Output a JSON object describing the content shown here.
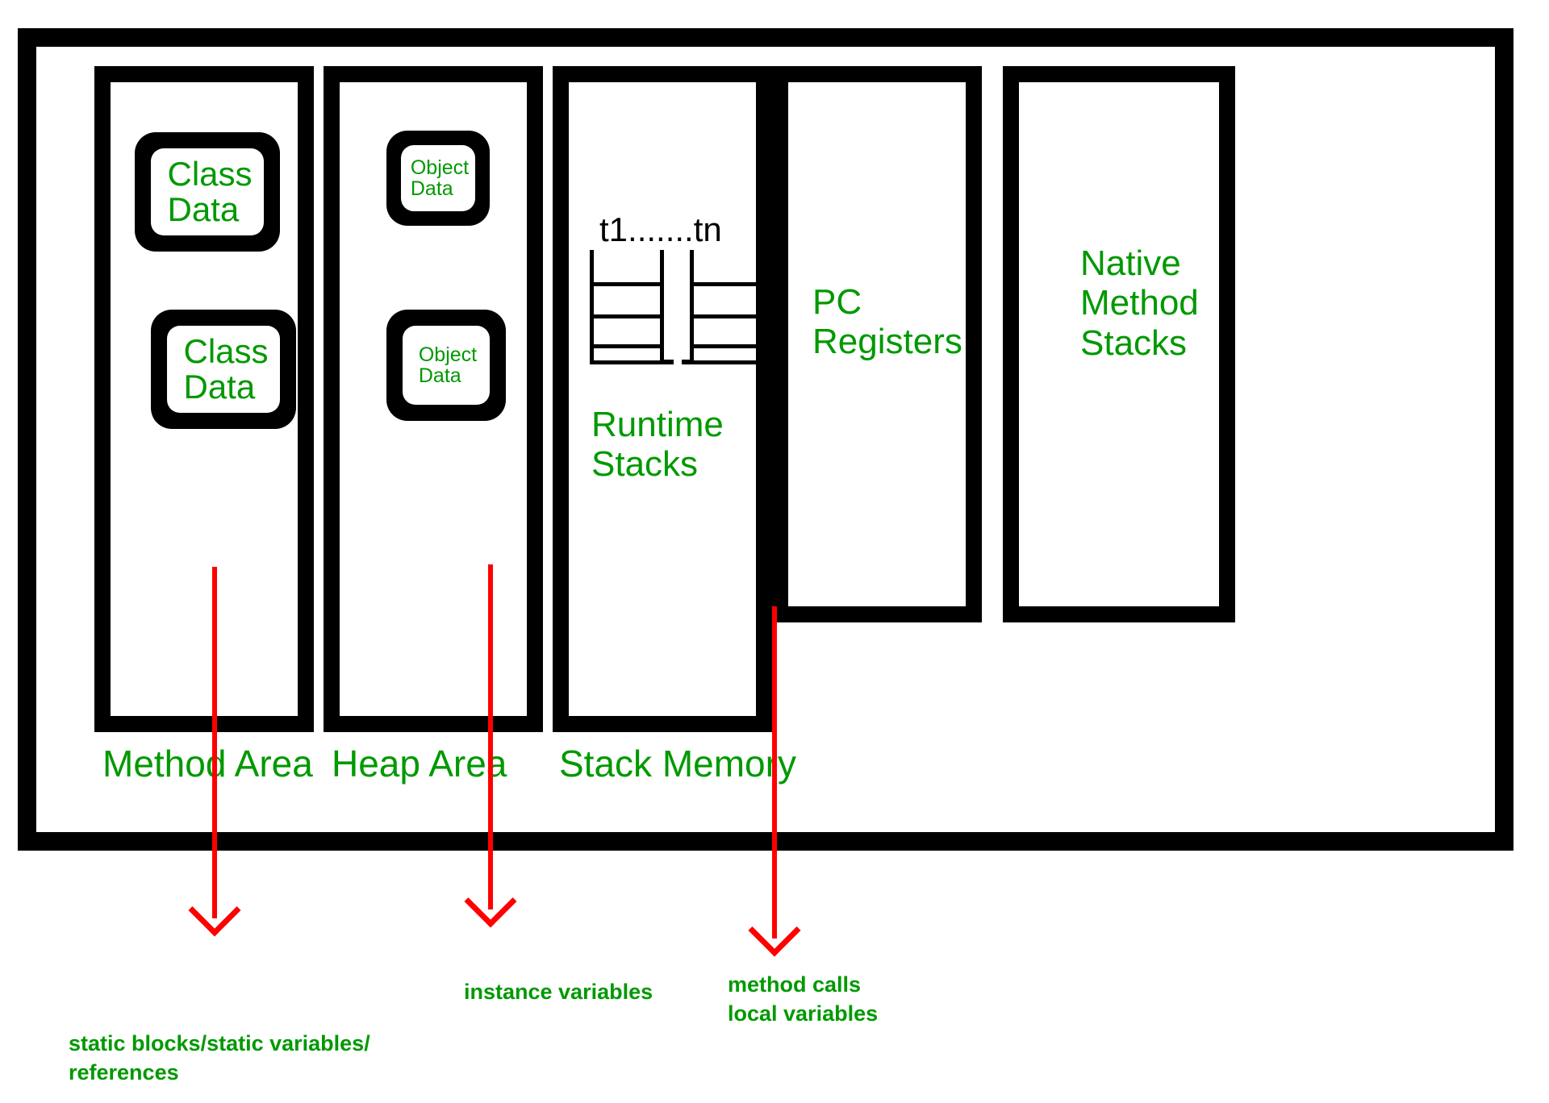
{
  "diagram": {
    "title": "JVM Memory Architecture",
    "accent_color": "#009900",
    "arrow_color": "#ff0000",
    "border_color": "#000000"
  },
  "areas": [
    {
      "id": "method-area",
      "caption": "Method Area",
      "chips": [
        {
          "id": "class-data-1",
          "label": "Class\nData"
        },
        {
          "id": "class-data-2",
          "label": "Class\nData"
        }
      ]
    },
    {
      "id": "heap-area",
      "caption": "Heap Area",
      "chips": [
        {
          "id": "object-data-1",
          "label": "Object\nData"
        },
        {
          "id": "object-data-2",
          "label": "Object\nData"
        }
      ]
    },
    {
      "id": "stack-memory",
      "caption": "Stack Memory",
      "thread_label": "t1.......tn",
      "inner_label": "Runtime\nStacks"
    },
    {
      "id": "pc-registers",
      "caption": "",
      "inner_label": "PC\nRegisters"
    },
    {
      "id": "native-method-stacks",
      "caption": "",
      "inner_label": "Native\nMethod\nStacks"
    }
  ],
  "annotations": [
    {
      "id": "method-area-note",
      "text": "static blocks/static variables/\nreferences"
    },
    {
      "id": "heap-area-note",
      "text": "instance variables"
    },
    {
      "id": "stack-memory-note",
      "text": "method calls\nlocal variables"
    }
  ]
}
